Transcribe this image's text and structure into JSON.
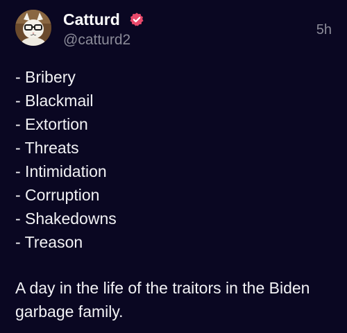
{
  "post": {
    "author": {
      "name": "Catturd",
      "handle": "@catturd2",
      "avatar": "cat-with-glasses-avatar",
      "verified_badge": "verified-badge-icon",
      "verified_color": "#e8496b"
    },
    "timestamp": "5h",
    "list_items": [
      "- Bribery",
      "- Blackmail",
      "- Extortion",
      "- Threats",
      "- Intimidation",
      "- Corruption",
      "- Shakedowns",
      "- Treason"
    ],
    "body_text": "A day in the life of the traitors in the Biden garbage family."
  },
  "colors": {
    "background": "#0a0722",
    "text_primary": "#f2f2f5",
    "text_secondary": "#8b8b98"
  }
}
